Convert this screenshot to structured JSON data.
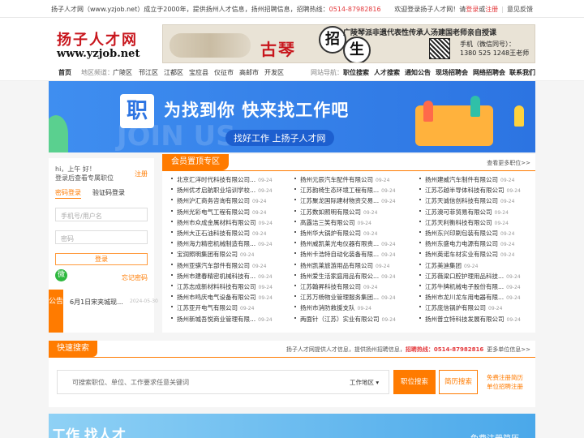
{
  "topbar": {
    "intro_pre": "扬子人才网（www.yzjob.net）成立于2000年，提供扬州人才信息，扬州招聘信息，招聘热线：",
    "hotline": "0514-87982816",
    "welcome": "欢迎登录扬子人才网！请",
    "login": "登录",
    "or": "或",
    "register": "注册",
    "feedback": "意见反馈"
  },
  "header": {
    "logo_cn": "扬子人才网",
    "logo_en": "www.yzjob.net",
    "banner_title": "广陵琴派非遗代表性传承人汤建国老师亲自授课",
    "banner_gu": "古琴",
    "banner_zhao": "招",
    "banner_sheng": "生",
    "banner_phone_label": "手机（微信同号）：",
    "banner_phone": "1380 525 1248王老师"
  },
  "nav": {
    "home": "首页",
    "region_label": "地区频道：",
    "regions": [
      "广陵区",
      "邗江区",
      "江都区",
      "宝应县",
      "仪征市",
      "高邮市",
      "开发区"
    ],
    "site_label": "网站导航：",
    "links": [
      "职位搜索",
      "人才搜索",
      "通知公告",
      "现场招聘会",
      "网络招聘会",
      "联系我们"
    ]
  },
  "hero": {
    "zhi": "职",
    "slogan": "为找到你  快来找工作吧",
    "sub": "找好工作 上扬子人才网",
    "bg": "JOIN US"
  },
  "login": {
    "greet1": "hi，上午 好！",
    "greet2": "登录后查看专属职位",
    "register": "注册",
    "tab_active": "密码登录",
    "tab_other": "验证码登录",
    "username_ph": "手机号/用户名",
    "password_ph": "密码",
    "login_btn": "登录",
    "wechat": "微",
    "forgot": "忘记密码",
    "notice_tag": "公告",
    "notice_text": "6月1日宋夹城现...",
    "notice_date": "2024-05-30"
  },
  "companies": {
    "tag": "会员置顶专区",
    "more": "查看更多职位>>",
    "date": "09-24",
    "col1": [
      "北京汇洋时代科技有限公司...",
      "扬州优才启航职业培训学校...",
      "扬州沪汇商务咨询有限公司",
      "扬州光彩电气工程有限公司",
      "扬州市众成金属材料有限公司",
      "扬州大正石油科技有限公司",
      "扬州海力精密机械制造有限...",
      "宝润照明集团有限公司",
      "扬州亚骐汽车部件有限公司",
      "扬州市建春精密机械科技有...",
      "江苏志成新材料科技有限公司",
      "扬州市鸣庆电气设备有限公司",
      "江苏亚开电气有限公司",
      "扬州新城吾悦商业管理有限..."
    ],
    "col2": [
      "扬州元辰汽车配件有限公司",
      "江苏韵椅生态环境工程有限...",
      "江苏聚龙国际建材物资交易...",
      "江苏数如照明有限公司",
      "高露洁三笑有限公司",
      "扬州华大锅炉有限公司",
      "扬州威凯莱光电仪器有限责...",
      "扬州卡浩特自动化装备有限...",
      "扬州凯莱旅游用品有限公司",
      "扬州爱生活家庭用品有限公...",
      "江苏翰昇科技有限公司",
      "江苏万杨物业管理服务集团...",
      "扬州市消防救援支队",
      "两面针（江苏）实业有限公司"
    ],
    "col3": [
      "扬州建威汽车制件有限公司",
      "江苏芯越半导体科技有限公司",
      "江苏天诚信创科技有限公司",
      "江苏澳可菲贸易有限公司",
      "江苏天利衡科技有限公司",
      "扬州东兴印刷包装有限公司",
      "扬州东盛电力电源有限公司",
      "扬州英诺车材实业有限公司",
      "江苏美迪集团",
      "江苏薇梁口腔护理用品科技...",
      "江苏牛牌机械电子股份有限...",
      "扬州市龙川龙车用电器有限...",
      "江苏庞信锅炉有限公司",
      "扬州普立特科技发展有限公司"
    ]
  },
  "quick": {
    "tag": "快速搜索",
    "info_pre": "扬子人才网提供人才信息，提供扬州招聘信息，",
    "hotline": "招聘热线：0514-87982816",
    "more": "更多单位信息>>",
    "placeholder": "可搜索职位、单位、工作要求任意关键词",
    "area": "工作地区",
    "job_btn": "职位搜索",
    "resume_btn": "简历搜索",
    "reg1": "免费注册简历",
    "reg2": "单位招聘注册"
  },
  "bottom": {
    "title": "工作 找人才",
    "right": "免费注册简历"
  }
}
